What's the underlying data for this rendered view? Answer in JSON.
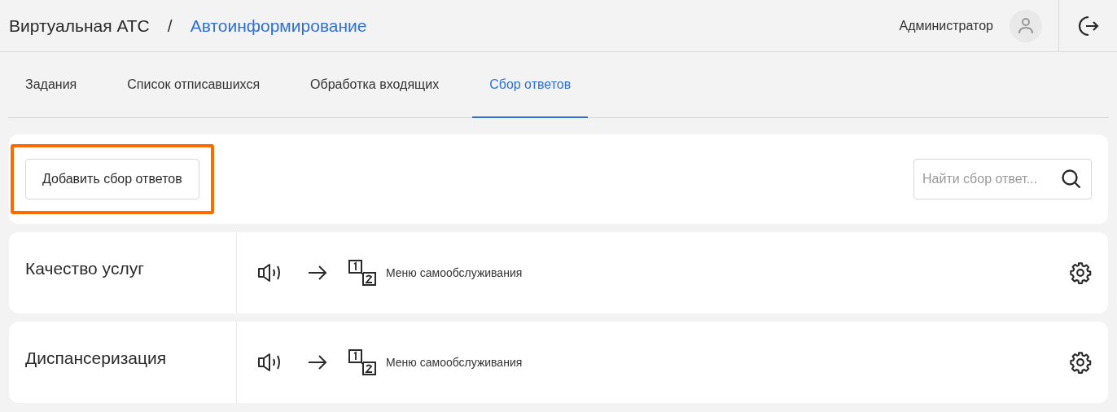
{
  "header": {
    "app_title": "Виртуальная АТС",
    "separator": "/",
    "section_title": "Автоинформирование",
    "user_name": "Администратор"
  },
  "tabs": [
    {
      "label": "Задания",
      "selected": false
    },
    {
      "label": "Список отписавшихся",
      "selected": false
    },
    {
      "label": "Обработка входящих",
      "selected": false
    },
    {
      "label": "Сбор ответов",
      "selected": true
    }
  ],
  "toolbar": {
    "add_button": {
      "label": "Добавить сбор ответов",
      "highlighted": true
    },
    "search": {
      "placeholder": "Найти сбор ответ..."
    }
  },
  "items": [
    {
      "name": "Качество услуг",
      "target": "Меню самообслуживания"
    },
    {
      "name": "Диспансеризация",
      "target": "Меню самообслуживания"
    }
  ]
}
